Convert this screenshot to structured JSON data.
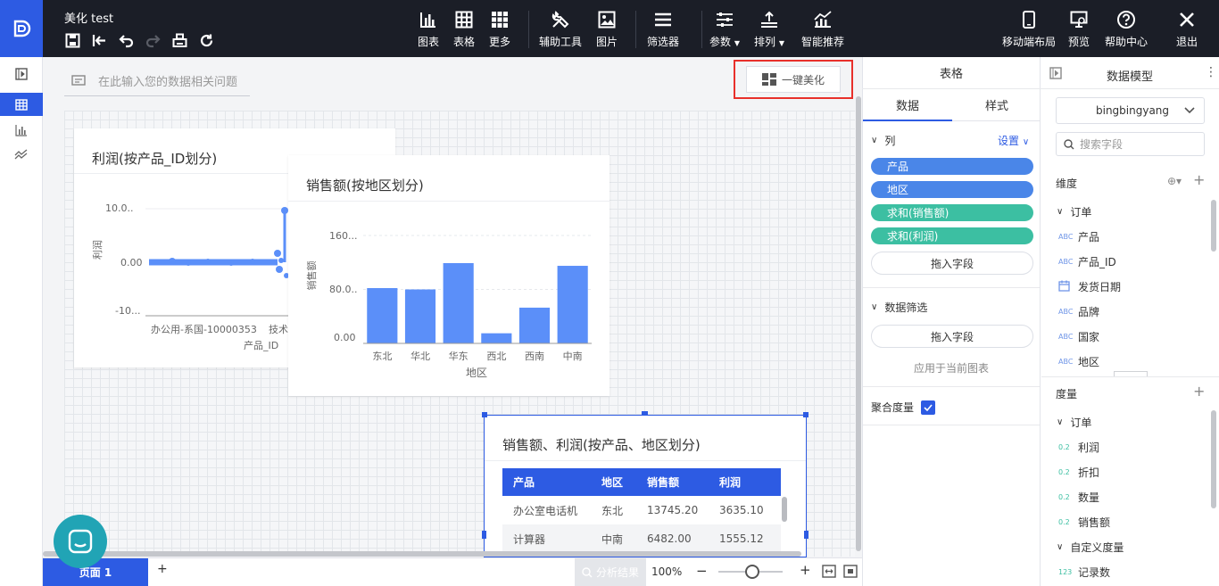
{
  "header": {
    "doc_title": "美化 test",
    "toolbar": [
      {
        "label": "图表",
        "icon": "bar-chart-icon"
      },
      {
        "label": "表格",
        "icon": "table-icon"
      },
      {
        "label": "更多",
        "icon": "grid-more-icon"
      },
      {
        "label": "辅助工具",
        "icon": "tools-icon"
      },
      {
        "label": "图片",
        "icon": "image-icon"
      },
      {
        "label": "筛选器",
        "icon": "filter-icon"
      },
      {
        "label": "参数",
        "icon": "params-icon"
      },
      {
        "label": "排列",
        "icon": "arrange-icon"
      },
      {
        "label": "智能推荐",
        "icon": "recommend-icon"
      }
    ],
    "right": [
      {
        "label": "移动端布局",
        "icon": "mobile-icon"
      },
      {
        "label": "预览",
        "icon": "preview-icon"
      },
      {
        "label": "帮助中心",
        "icon": "help-icon"
      },
      {
        "label": "退出",
        "icon": "close-icon"
      }
    ]
  },
  "question_placeholder": "在此输入您的数据相关问题",
  "beautify_label": "一键美化",
  "card1": {
    "title": "利润(按产品_ID划分)",
    "ylabel": "利润",
    "yticks": [
      "10.0..",
      "0.00",
      "-10..."
    ],
    "xtick": "办公用-系国-10000353",
    "xtick2": "技术",
    "xlabel": "产品_ID"
  },
  "card2": {
    "title": "销售额(按地区划分)",
    "ylabel": "销售额",
    "xlabel": "地区",
    "yticks": [
      "160...",
      "80.0..",
      "0.00"
    ]
  },
  "chart_data": [
    {
      "type": "bar",
      "title": "销售额(按地区划分)",
      "categories": [
        "东北",
        "华北",
        "华东",
        "西北",
        "西南",
        "中南"
      ],
      "values": [
        82,
        80,
        119,
        15,
        53,
        115
      ],
      "ylim": [
        0,
        160
      ],
      "xlabel": "地区",
      "ylabel": "销售额",
      "color": "#5b8ff9"
    },
    {
      "type": "line",
      "title": "利润(按产品_ID划分)",
      "xlabel": "产品_ID",
      "ylabel": "利润",
      "ylim": [
        -10,
        10
      ],
      "color": "#5b8ff9"
    }
  ],
  "table_card": {
    "title": "销售额、利润(按产品、地区划分)",
    "headers": [
      "产品",
      "地区",
      "销售额",
      "利润"
    ],
    "rows": [
      [
        "办公室电话机",
        "东北",
        "13745.20",
        "3635.10"
      ],
      [
        "计算器",
        "中南",
        "6482.00",
        "1555.12"
      ]
    ]
  },
  "footer": {
    "page_tab": "页面 1",
    "add": "+",
    "analyze": "分析结果",
    "zoom": "100%",
    "minus": "−",
    "plus": "+"
  },
  "mid_panel": {
    "title": "表格",
    "tabs": [
      "数据",
      "样式"
    ],
    "columns_label": "列",
    "settings": "设置",
    "pills": [
      {
        "label": "产品",
        "color": "#4a86e8"
      },
      {
        "label": "地区",
        "color": "#4a86e8"
      },
      {
        "label": "求和(销售额)",
        "color": "#3cbfa2"
      },
      {
        "label": "求和(利润)",
        "color": "#3cbfa2"
      }
    ],
    "drag_field": "拖入字段",
    "filter_label": "数据筛选",
    "drag_field2": "拖入字段",
    "apply_to": "应用于当前图表",
    "aggregate": "聚合度量"
  },
  "right_panel": {
    "title": "数据模型",
    "dataset": "bingbingyang",
    "search_placeholder": "搜索字段",
    "dims_label": "维度",
    "dim_group": "订单",
    "dims": [
      {
        "t": "ABC",
        "n": "产品"
      },
      {
        "t": "ABC",
        "n": "产品_ID"
      },
      {
        "t": "DATE",
        "n": "发货日期"
      },
      {
        "t": "ABC",
        "n": "品牌"
      },
      {
        "t": "ABC",
        "n": "国家"
      },
      {
        "t": "ABC",
        "n": "地区"
      }
    ],
    "measures_label": "度量",
    "measure_group": "订单",
    "measures": [
      {
        "t": "0.2",
        "n": "利润"
      },
      {
        "t": "0.2",
        "n": "折扣"
      },
      {
        "t": "0.2",
        "n": "数量"
      },
      {
        "t": "0.2",
        "n": "销售额"
      }
    ],
    "custom_group": "自定义度量",
    "custom": [
      {
        "t": "123",
        "n": "记录数"
      }
    ]
  }
}
